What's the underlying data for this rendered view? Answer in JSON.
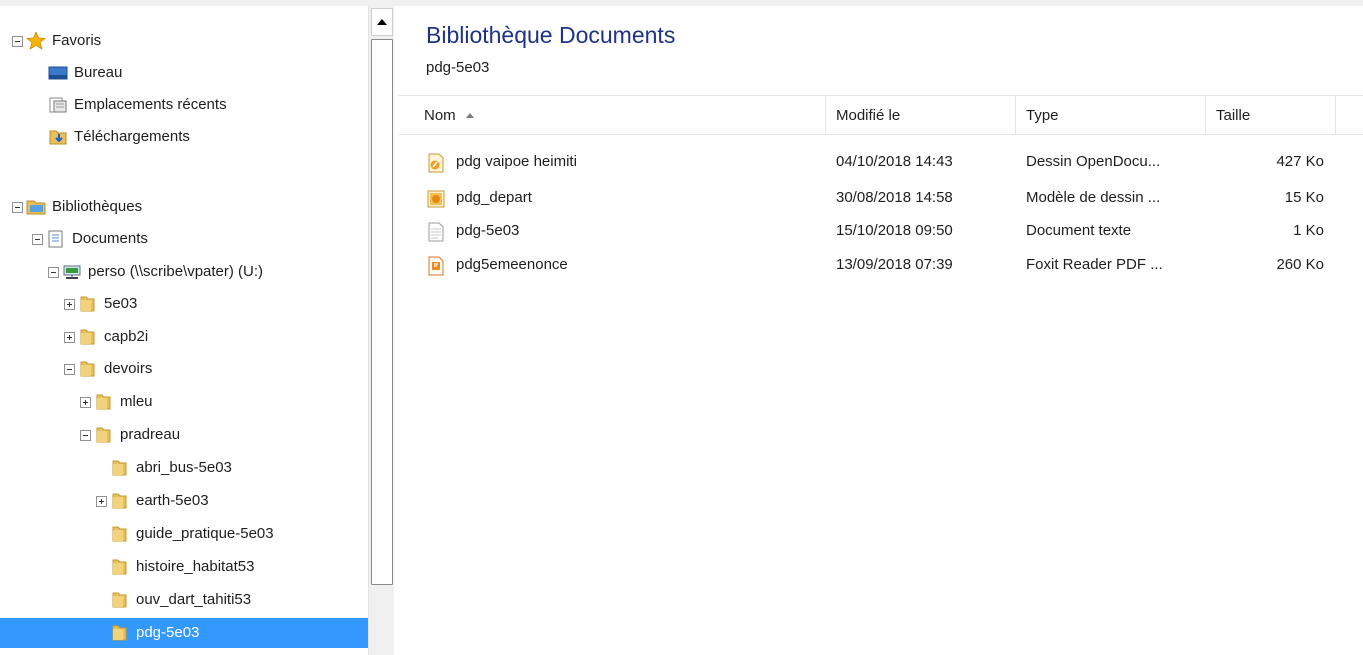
{
  "navigation": {
    "favorites": {
      "label": "Favoris",
      "items": [
        {
          "label": "Bureau"
        },
        {
          "label": "Emplacements récents"
        },
        {
          "label": "Téléchargements"
        }
      ]
    },
    "libraries": {
      "label": "Bibliothèques",
      "documents": {
        "label": "Documents",
        "drive": {
          "label": "perso (\\\\scribe\\vpater) (U:)",
          "folders": [
            {
              "label": "5e03"
            },
            {
              "label": "capb2i"
            },
            {
              "label": "devoirs"
            },
            {
              "label": "mleu"
            },
            {
              "label": "pradreau"
            },
            {
              "label": "abri_bus-5e03"
            },
            {
              "label": "earth-5e03"
            },
            {
              "label": "guide_pratique-5e03"
            },
            {
              "label": "histoire_habitat53"
            },
            {
              "label": "ouv_dart_tahiti53"
            },
            {
              "label": "pdg-5e03"
            }
          ]
        }
      }
    }
  },
  "content": {
    "title": "Bibliothèque Documents",
    "subtitle": "pdg-5e03",
    "columns": {
      "name": "Nom",
      "modified": "Modifié le",
      "type": "Type",
      "size": "Taille"
    },
    "files": [
      {
        "name": "pdg vaipoe heimiti",
        "modified": "04/10/2018 14:43",
        "type": "Dessin OpenDocu...",
        "size": "427 Ko"
      },
      {
        "name": "pdg_depart",
        "modified": "30/08/2018 14:58",
        "type": "Modèle de dessin ...",
        "size": "15 Ko"
      },
      {
        "name": "pdg-5e03",
        "modified": "15/10/2018 09:50",
        "type": "Document texte",
        "size": "1 Ko"
      },
      {
        "name": "pdg5emeenonce",
        "modified": "13/09/2018 07:39",
        "type": "Foxit Reader PDF ...",
        "size": "260 Ko"
      }
    ]
  },
  "colors": {
    "selection": "#3399ff",
    "title": "#1e3287",
    "folder": "#e8c05a"
  }
}
